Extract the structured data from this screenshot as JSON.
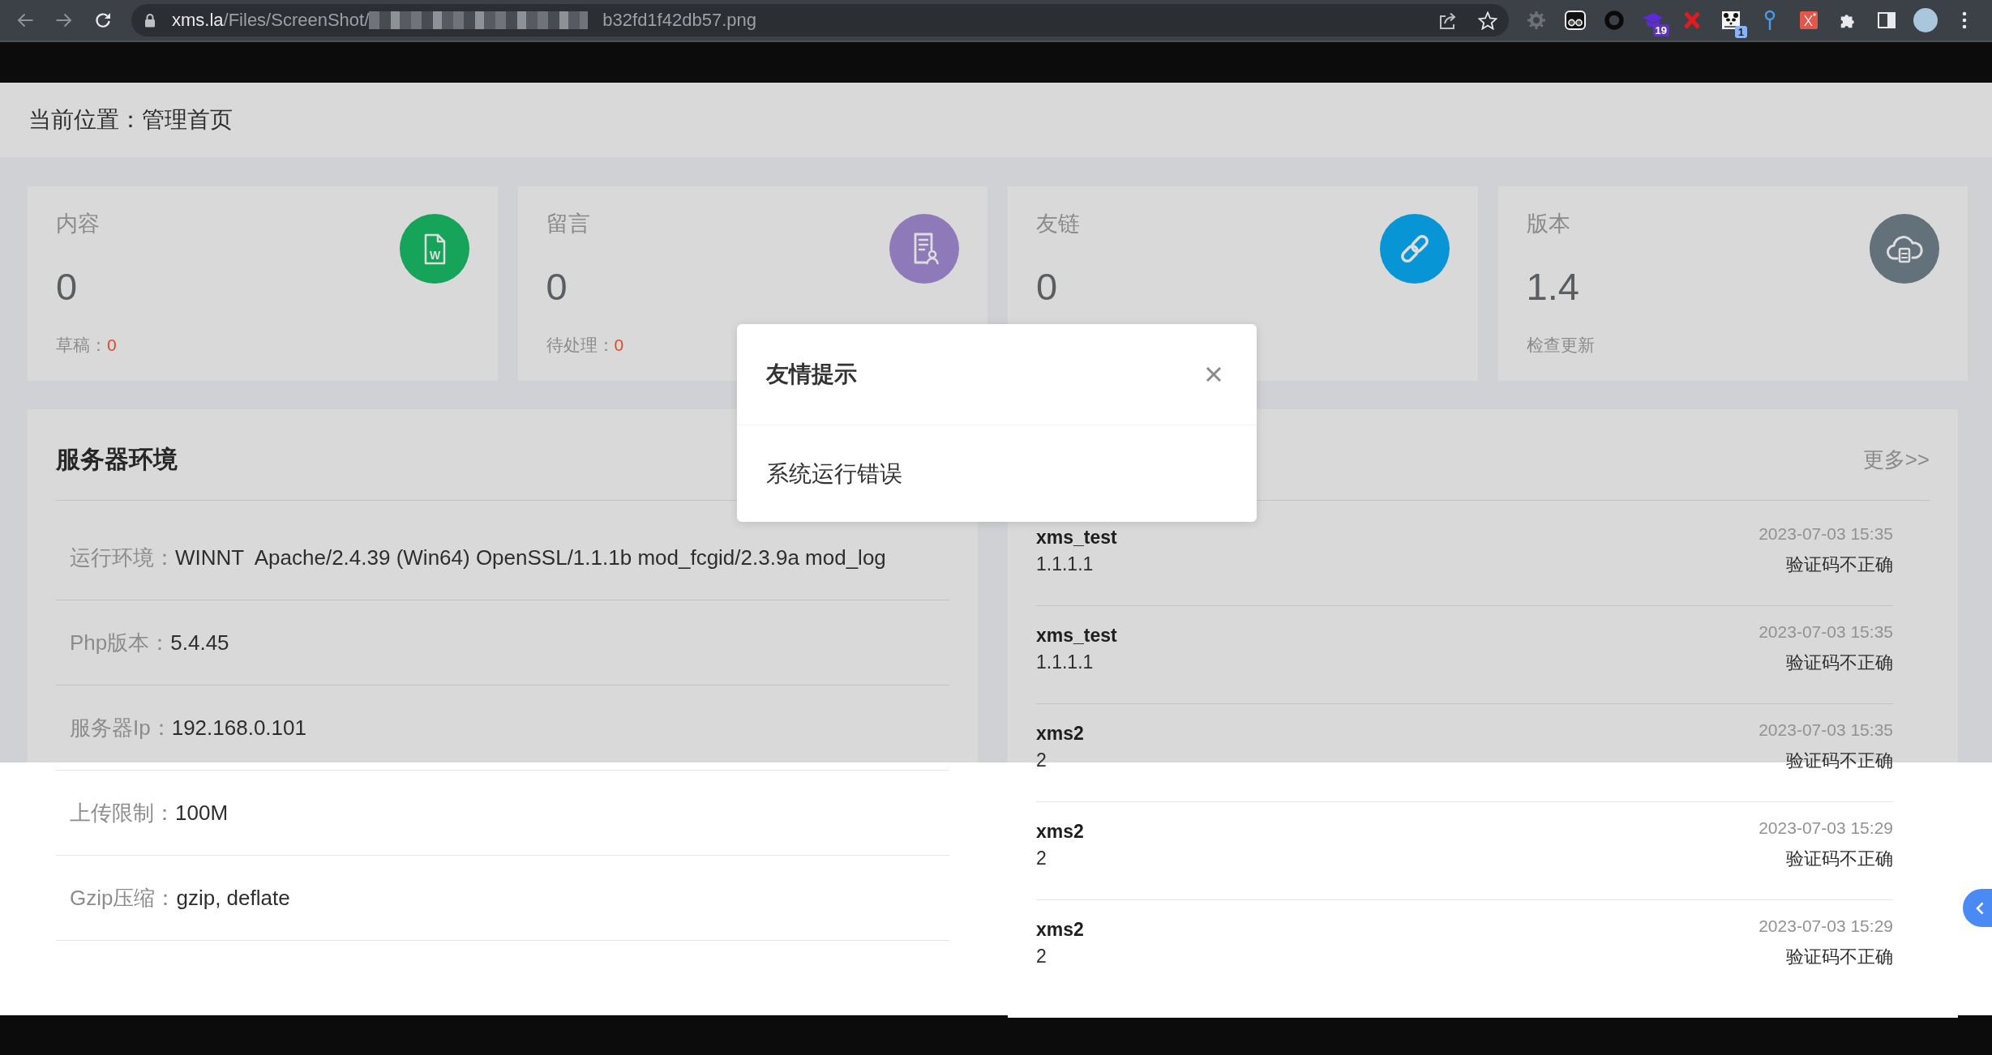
{
  "browser": {
    "url_host": "xms.la",
    "url_path": "/Files/ScreenShot/",
    "url_tail": "b32fd1f42db57.png",
    "extension_badges": [
      "19",
      "1"
    ]
  },
  "breadcrumb": "当前位置：管理首页",
  "stat_cards": [
    {
      "title": "内容",
      "value": "0",
      "color": "#16a35a",
      "icon_text": "W",
      "footer": {
        "label": "草稿：",
        "count": "0"
      }
    },
    {
      "title": "留言",
      "value": "0",
      "color": "#8e79b9",
      "footer": {
        "label": "待处理：",
        "count": "0"
      }
    },
    {
      "title": "友链",
      "value": "0",
      "color": "#0895d6"
    },
    {
      "title": "版本",
      "value": "1.4",
      "color": "#63727a",
      "footer": {
        "link": "检查更新"
      }
    }
  ],
  "server_panel": {
    "title": "服务器环境",
    "rows": [
      {
        "label": "运行环境：",
        "value": "WINNT  Apache/2.4.39 (Win64) OpenSSL/1.1.1b mod_fcgid/2.3.9a mod_log"
      },
      {
        "label": "Php版本：",
        "value": "5.4.45"
      },
      {
        "label": "服务器Ip：",
        "value": "192.168.0.101"
      },
      {
        "label": "上传限制：",
        "value": "100M"
      },
      {
        "label": "Gzip压缩：",
        "value": "gzip, deflate"
      }
    ]
  },
  "log_panel": {
    "more_link": "更多>>",
    "entries": [
      {
        "user": "xms_test",
        "ip": "1.1.1.1",
        "time": "2023-07-03 15:35",
        "message": "验证码不正确"
      },
      {
        "user": "xms_test",
        "ip": "1.1.1.1",
        "time": "2023-07-03 15:35",
        "message": "验证码不正确"
      },
      {
        "user": "xms2",
        "ip": "2",
        "time": "2023-07-03 15:35",
        "message": "验证码不正确"
      },
      {
        "user": "xms2",
        "ip": "2",
        "time": "2023-07-03 15:29",
        "message": "验证码不正确"
      },
      {
        "user": "xms2",
        "ip": "2",
        "time": "2023-07-03 15:29",
        "message": "验证码不正确"
      }
    ]
  },
  "dialog": {
    "title": "友情提示",
    "message": "系统运行错误"
  }
}
